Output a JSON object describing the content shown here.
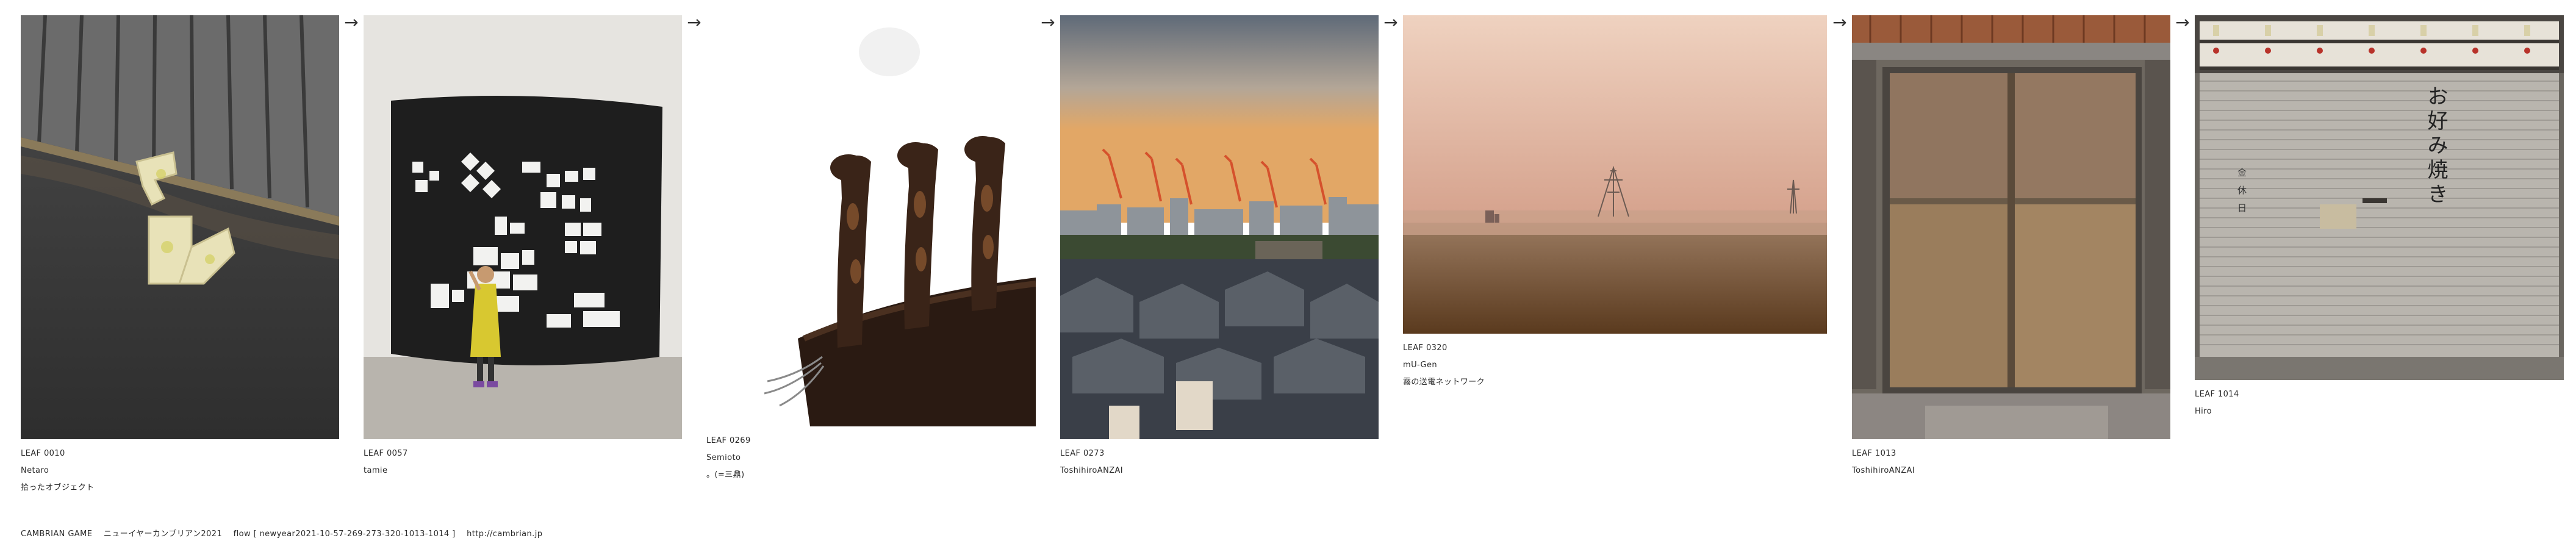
{
  "leaves": [
    {
      "id": "LEAF 0010",
      "author": "Netaro",
      "title": "拾ったオブジェクト"
    },
    {
      "id": "LEAF 0057",
      "author": "tamie",
      "title": ""
    },
    {
      "id": "LEAF 0269",
      "author": "Semioto",
      "title": "。(=三鼎)"
    },
    {
      "id": "LEAF 0273",
      "author": "ToshihiroANZAI",
      "title": ""
    },
    {
      "id": "LEAF 0320",
      "author": "mU-Gen",
      "title": "霧の送電ネットワーク"
    },
    {
      "id": "LEAF 1013",
      "author": "ToshihiroANZAI",
      "title": ""
    },
    {
      "id": "LEAF 1014",
      "author": "Hiro",
      "title": ""
    }
  ],
  "arrow_glyph": "→",
  "shop_sign": {
    "vertical_text": "お好み焼き",
    "holiday_text": "金休日"
  },
  "footer": {
    "game": "CAMBRIAN GAME",
    "event": "ニューイヤーカンブリアン2021",
    "flow": "flow [ newyear2021-10-57-269-273-320-1013-1014 ]",
    "url": "http://cambrian.jp"
  }
}
